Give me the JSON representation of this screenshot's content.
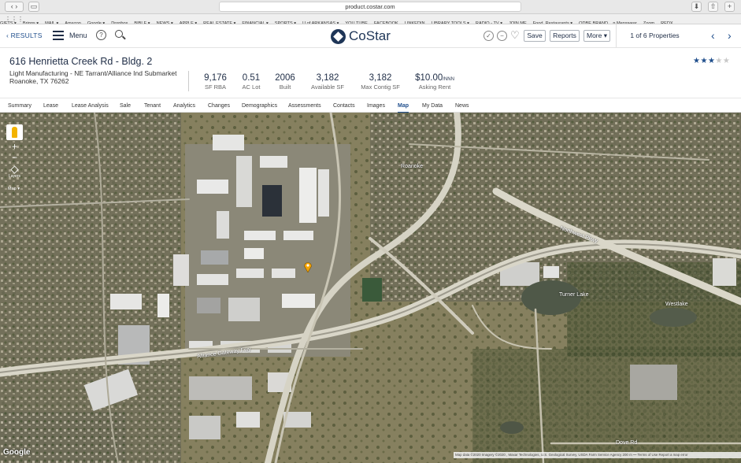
{
  "browser": {
    "url": "product.costar.com",
    "bookmarks": [
      "GIFTS ▾",
      "Briggs ▾",
      "MAIL ▾",
      "Amazon",
      "Google ▾",
      "Dropbox",
      "BIBLE ▾",
      "NEWS ▾",
      "APPLE ▾",
      "REAL ESTATE ▾",
      "FINANCIAL ▾",
      "SPORTS ▾",
      "U of ARKANSAS ▾",
      "YOU TUBE",
      "FACEBOOK",
      "LINKEDIN",
      "LIBRARY TOOLS ▾",
      "RADIO - TV ▾",
      "JOIN.ME",
      "Food, Restaurants ▾",
      "ODBE BRAND ...n Menswear",
      "Zoom",
      "REDX"
    ]
  },
  "appbar": {
    "results": "RESULTS",
    "menu": "Menu",
    "logo": "CoStar",
    "save": "Save",
    "reports": "Reports",
    "more": "More",
    "counter": "1 of 6 Properties"
  },
  "property": {
    "address": "616 Henrietta Creek Rd - Bldg. 2",
    "subtitle": "Light Manufacturing - NE Tarrant/Alliance Ind Submarket",
    "city": "Roanoke, TX 76262",
    "rating": 3,
    "rating_max": 5
  },
  "stats": [
    {
      "value": "9,176",
      "label": "SF RBA"
    },
    {
      "value": "0.51",
      "label": "AC Lot"
    },
    {
      "value": "2006",
      "label": "Built"
    },
    {
      "value": "3,182",
      "label": "Available SF"
    },
    {
      "value": "3,182",
      "label": "Max Contig SF"
    },
    {
      "value": "$10.00",
      "unit": "/NNN",
      "label": "Asking Rent"
    }
  ],
  "tabs": [
    "Summary",
    "Lease",
    "Lease Analysis",
    "Sale",
    "Tenant",
    "Analytics",
    "Changes",
    "Demographics",
    "Assessments",
    "Contacts",
    "Images",
    "Map",
    "My Data",
    "News"
  ],
  "active_tab": "Map",
  "map": {
    "layers": "Layers",
    "map_type": "Map ▾",
    "google": "Google",
    "attribution": "Map data ©2020 Imagery ©2020 , Maxar Technologies, U.S. Geological Survey, USDA Farm Service Agency   200 m ⎯⎯   Terms of Use   Report a map error",
    "labels": {
      "northwest_pkwy": "Northwest Pkwy",
      "alliance_gateway": "Alliance Gateway Fwy",
      "turner_lake": "Turner Lake",
      "westlake": "Westlake",
      "dove_rd": "Dove Rd",
      "roanoke": "Roanoke"
    }
  },
  "colors": {
    "brand": "#1e3557",
    "link": "#1f4e8c",
    "star_on": "#1f4e8c",
    "star_off": "#c8c8c8",
    "pin": "#f3a300"
  }
}
